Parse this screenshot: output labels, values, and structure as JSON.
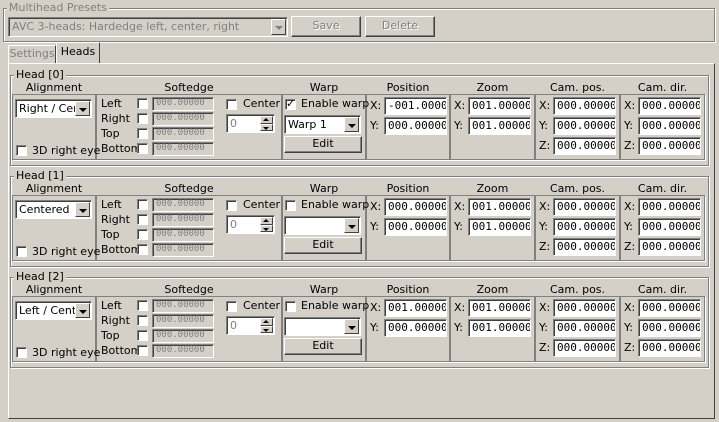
{
  "presets": {
    "title": "Multihead Presets",
    "selected": "AVC 3-heads: Hardedge left, center, right",
    "save_label": "Save",
    "delete_label": "Delete"
  },
  "tabs": [
    {
      "label": "Settings",
      "active": false
    },
    {
      "label": "Heads",
      "active": true
    }
  ],
  "columns": {
    "alignment": "Alignment",
    "softedge": "Softedge",
    "warp": "Warp",
    "position": "Position",
    "zoom": "Zoom",
    "cam_pos": "Cam. pos.",
    "cam_dir": "Cam. dir."
  },
  "labels": {
    "left": "Left",
    "right": "Right",
    "top": "Top",
    "bottom": "Bottom",
    "center": "Center",
    "enable_warp": "Enable warp",
    "edit": "Edit",
    "right_eye": "3D right eye",
    "x": "X:",
    "y": "Y:",
    "z": "Z:"
  },
  "heads": [
    {
      "title": "Head [0]",
      "alignment": "Right / Cen",
      "right_eye": false,
      "softedge": {
        "left": "000.00000",
        "right": "000.00000",
        "top": "000.00000",
        "bottom": "000.00000"
      },
      "center": false,
      "center_value": "0",
      "warp_enabled": true,
      "warp_selected": "Warp 1",
      "position": {
        "x": "-001.00000",
        "y": "000.00000"
      },
      "zoom": {
        "x": "001.00000",
        "y": "001.00000"
      },
      "cam_pos": {
        "x": "000.00000",
        "y": "000.00000",
        "z": "000.00000"
      },
      "cam_dir": {
        "x": "000.00000",
        "y": "000.00000",
        "z": "000.00000"
      }
    },
    {
      "title": "Head [1]",
      "alignment": "Centered",
      "right_eye": false,
      "softedge": {
        "left": "000.00000",
        "right": "000.00000",
        "top": "000.00000",
        "bottom": "000.00000"
      },
      "center": false,
      "center_value": "0",
      "warp_enabled": false,
      "warp_selected": "",
      "position": {
        "x": "000.00000",
        "y": "000.00000"
      },
      "zoom": {
        "x": "001.00000",
        "y": "001.00000"
      },
      "cam_pos": {
        "x": "000.00000",
        "y": "000.00000",
        "z": "000.00000"
      },
      "cam_dir": {
        "x": "000.00000",
        "y": "000.00000",
        "z": "000.00000"
      }
    },
    {
      "title": "Head [2]",
      "alignment": "Left / Cente",
      "right_eye": false,
      "softedge": {
        "left": "000.00000",
        "right": "000.00000",
        "top": "000.00000",
        "bottom": "000.00000"
      },
      "center": false,
      "center_value": "0",
      "warp_enabled": false,
      "warp_selected": "",
      "position": {
        "x": "001.00000",
        "y": "000.00000"
      },
      "zoom": {
        "x": "001.00000",
        "y": "001.00000"
      },
      "cam_pos": {
        "x": "000.00000",
        "y": "000.00000",
        "z": "000.00000"
      },
      "cam_dir": {
        "x": "000.00000",
        "y": "000.00000",
        "z": "000.00000"
      }
    }
  ]
}
